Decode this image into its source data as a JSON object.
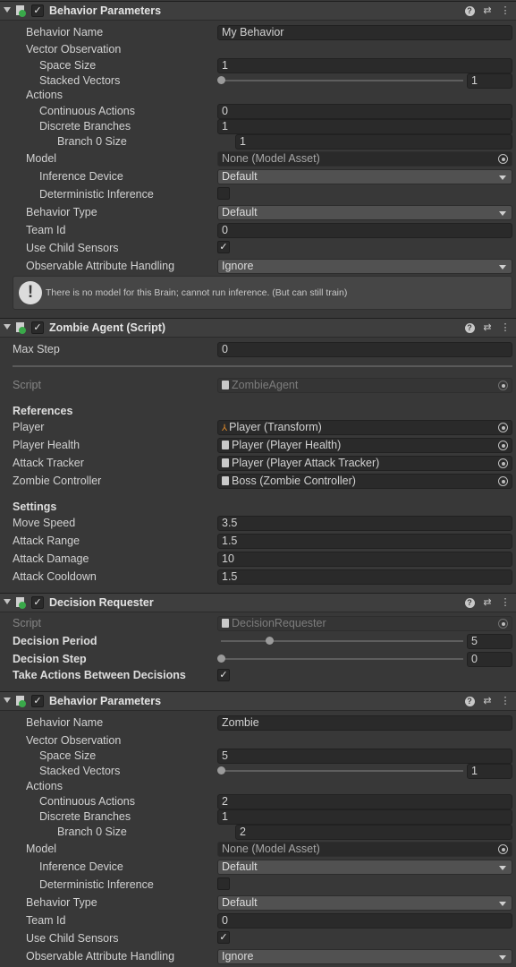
{
  "bp1": {
    "title": "Behavior Parameters",
    "behavior_name_label": "Behavior Name",
    "behavior_name_value": "My Behavior",
    "vector_observation_label": "Vector Observation",
    "space_size_label": "Space Size",
    "space_size_value": "1",
    "stacked_vectors_label": "Stacked Vectors",
    "stacked_vectors_value": "1",
    "actions_label": "Actions",
    "continuous_actions_label": "Continuous Actions",
    "continuous_actions_value": "0",
    "discrete_branches_label": "Discrete Branches",
    "discrete_branches_value": "1",
    "branch0_label": "Branch 0 Size",
    "branch0_value": "1",
    "model_label": "Model",
    "model_value": "None (Model Asset)",
    "inference_device_label": "Inference Device",
    "inference_device_value": "Default",
    "deterministic_label": "Deterministic Inference",
    "behavior_type_label": "Behavior Type",
    "behavior_type_value": "Default",
    "team_id_label": "Team Id",
    "team_id_value": "0",
    "use_child_sensors_label": "Use Child Sensors",
    "observable_label": "Observable Attribute Handling",
    "observable_value": "Ignore",
    "help_text": "There is no model for this Brain; cannot run inference. (But can still train)"
  },
  "za": {
    "title": "Zombie Agent (Script)",
    "max_step_label": "Max Step",
    "max_step_value": "0",
    "script_label": "Script",
    "script_value": "ZombieAgent",
    "references_label": "References",
    "player_label": "Player",
    "player_value": "Player (Transform)",
    "player_health_label": "Player Health",
    "player_health_value": "Player (Player Health)",
    "attack_tracker_label": "Attack Tracker",
    "attack_tracker_value": "Player (Player Attack Tracker)",
    "zombie_controller_label": "Zombie Controller",
    "zombie_controller_value": "Boss (Zombie Controller)",
    "settings_label": "Settings",
    "move_speed_label": "Move Speed",
    "move_speed_value": "3.5",
    "attack_range_label": "Attack Range",
    "attack_range_value": "1.5",
    "attack_damage_label": "Attack Damage",
    "attack_damage_value": "10",
    "attack_cooldown_label": "Attack Cooldown",
    "attack_cooldown_value": "1.5"
  },
  "dr": {
    "title": "Decision Requester",
    "script_label": "Script",
    "script_value": "DecisionRequester",
    "decision_period_label": "Decision Period",
    "decision_period_value": "5",
    "decision_period_fraction": 0.2,
    "decision_step_label": "Decision Step",
    "decision_step_value": "0",
    "take_actions_label": "Take Actions Between Decisions"
  },
  "bp2": {
    "title": "Behavior Parameters",
    "behavior_name_label": "Behavior Name",
    "behavior_name_value": "Zombie",
    "vector_observation_label": "Vector Observation",
    "space_size_label": "Space Size",
    "space_size_value": "5",
    "stacked_vectors_label": "Stacked Vectors",
    "stacked_vectors_value": "1",
    "actions_label": "Actions",
    "continuous_actions_label": "Continuous Actions",
    "continuous_actions_value": "2",
    "discrete_branches_label": "Discrete Branches",
    "discrete_branches_value": "1",
    "branch0_label": "Branch 0 Size",
    "branch0_value": "2",
    "model_label": "Model",
    "model_value": "None (Model Asset)",
    "inference_device_label": "Inference Device",
    "inference_device_value": "Default",
    "deterministic_label": "Deterministic Inference",
    "behavior_type_label": "Behavior Type",
    "behavior_type_value": "Default",
    "team_id_label": "Team Id",
    "team_id_value": "0",
    "use_child_sensors_label": "Use Child Sensors",
    "observable_label": "Observable Attribute Handling",
    "observable_value": "Ignore"
  },
  "icons": {
    "help": "help-icon",
    "presets": "presets-icon",
    "menu": "kebab-menu-icon",
    "component": "script-component-icon",
    "warning": "warning-icon"
  },
  "colors": {
    "panel_bg": "#383838",
    "field_bg": "#2a2a2a",
    "header_bg": "#3e3e3e"
  }
}
